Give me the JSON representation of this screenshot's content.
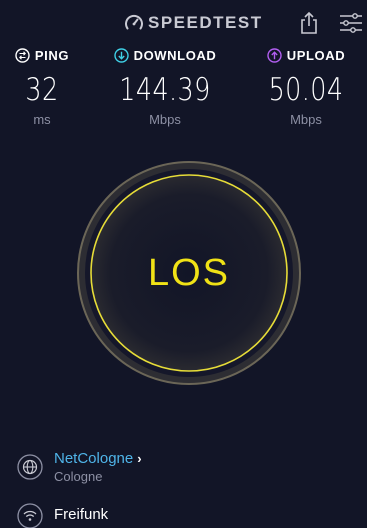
{
  "header": {
    "brand": "SPEEDTEST"
  },
  "metrics": {
    "ping": {
      "label": "PING",
      "value": "32",
      "unit": "ms",
      "icon_color": "#ffffff"
    },
    "download": {
      "label": "DOWNLOAD",
      "value": "144.39",
      "unit": "Mbps",
      "icon_color": "#3fd0e6"
    },
    "upload": {
      "label": "UPLOAD",
      "value": "50.04",
      "unit": "Mbps",
      "icon_color": "#b15ef0"
    }
  },
  "go": {
    "label": "LOS",
    "color": "#f0e216"
  },
  "isp": {
    "name": "NetCologne",
    "location": "Cologne"
  },
  "network": {
    "name": "Freifunk"
  },
  "colors": {
    "background": "#121527",
    "accent_blue": "#4fb4e8",
    "muted_text": "#8d90a4"
  }
}
